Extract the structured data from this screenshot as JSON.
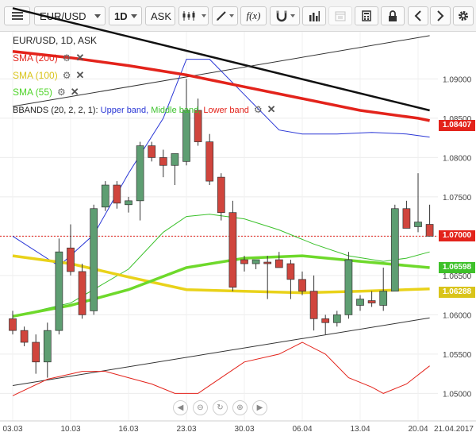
{
  "toolbar": {
    "symbol": "EUR/USD",
    "timeframe": "1D",
    "price_type": "ASK",
    "icons": [
      "hamburger-menu-icon",
      "candlestick-icon",
      "pencil-icon",
      "fx-icon",
      "magnet-icon",
      "bar-chart-icon",
      "calendar-icon",
      "calculator-icon",
      "lock-icon",
      "prev-icon",
      "next-icon",
      "gear-icon"
    ]
  },
  "legend": {
    "title": "EUR/USD, 1D, ASK",
    "sma200": "SMA (200)",
    "sma100": "SMA (100)",
    "sma55": "SMA (55)",
    "bbands_name": "BBANDS (20, 2, 2, 1):",
    "bbands_upper": "Upper band,",
    "bbands_middle": "Middle band,",
    "bbands_lower": "Lower band",
    "colors": {
      "sma200": "#e3231b",
      "sma100": "#e9d21a",
      "sma55": "#6ed92b",
      "upper": "#2a37d6",
      "middle": "#3bc12b",
      "lower": "#e3231b"
    }
  },
  "axis": {
    "y_ticks": [
      "1.09000",
      "1.08500",
      "1.08000",
      "1.07500",
      "1.07000",
      "1.06500",
      "1.06000",
      "1.05500",
      "1.05000"
    ],
    "x_ticks": [
      "03.03",
      "10.03",
      "16.03",
      "23.03",
      "30.03",
      "06.04",
      "13.04",
      "20.04"
    ],
    "x_end_label": "21.04.2017"
  },
  "price_labels": {
    "sma200": {
      "text": "1.08407",
      "color": "#e3231b"
    },
    "current": {
      "text": "1.07000",
      "color": "#e3231b"
    },
    "sma55": {
      "text": "1.06598",
      "color": "#3ec12a"
    },
    "sma100": {
      "text": "1.06288",
      "color": "#d9c41a"
    }
  },
  "nav_icons": [
    "scroll-left-icon",
    "zoom-out-icon",
    "zoom-reset-icon",
    "zoom-in-icon",
    "scroll-right-icon"
  ],
  "chart_data": {
    "type": "candlestick",
    "ylim": [
      1.0465,
      1.096
    ],
    "x_ticks": [
      "03.03",
      "10.03",
      "16.03",
      "23.03",
      "30.03",
      "06.04",
      "13.04",
      "20.04"
    ],
    "last_price": 1.07,
    "candles": [
      {
        "o": 1.0595,
        "h": 1.0605,
        "l": 1.0575,
        "c": 1.058
      },
      {
        "o": 1.058,
        "h": 1.0585,
        "l": 1.056,
        "c": 1.0565
      },
      {
        "o": 1.0565,
        "h": 1.0575,
        "l": 1.0525,
        "c": 1.054
      },
      {
        "o": 1.054,
        "h": 1.059,
        "l": 1.052,
        "c": 1.058
      },
      {
        "o": 1.058,
        "h": 1.0697,
        "l": 1.0575,
        "c": 1.068
      },
      {
        "o": 1.0685,
        "h": 1.0715,
        "l": 1.065,
        "c": 1.0655
      },
      {
        "o": 1.0655,
        "h": 1.0665,
        "l": 1.0595,
        "c": 1.06
      },
      {
        "o": 1.0605,
        "h": 1.074,
        "l": 1.06,
        "c": 1.0735
      },
      {
        "o": 1.0737,
        "h": 1.077,
        "l": 1.0732,
        "c": 1.0765
      },
      {
        "o": 1.0765,
        "h": 1.077,
        "l": 1.0735,
        "c": 1.0742
      },
      {
        "o": 1.074,
        "h": 1.075,
        "l": 1.073,
        "c": 1.0745
      },
      {
        "o": 1.0745,
        "h": 1.082,
        "l": 1.072,
        "c": 1.0815
      },
      {
        "o": 1.0815,
        "h": 1.082,
        "l": 1.0795,
        "c": 1.08
      },
      {
        "o": 1.08,
        "h": 1.081,
        "l": 1.0775,
        "c": 1.079
      },
      {
        "o": 1.079,
        "h": 1.0805,
        "l": 1.0765,
        "c": 1.0805
      },
      {
        "o": 1.0795,
        "h": 1.09,
        "l": 1.079,
        "c": 1.086
      },
      {
        "o": 1.086,
        "h": 1.0875,
        "l": 1.0815,
        "c": 1.082
      },
      {
        "o": 1.082,
        "h": 1.083,
        "l": 1.0765,
        "c": 1.077
      },
      {
        "o": 1.0775,
        "h": 1.078,
        "l": 1.072,
        "c": 1.073
      },
      {
        "o": 1.073,
        "h": 1.0745,
        "l": 1.063,
        "c": 1.0635
      },
      {
        "o": 1.067,
        "h": 1.0675,
        "l": 1.0655,
        "c": 1.0665
      },
      {
        "o": 1.0665,
        "h": 1.067,
        "l": 1.0658,
        "c": 1.067
      },
      {
        "o": 1.0667,
        "h": 1.0675,
        "l": 1.062,
        "c": 1.0665
      },
      {
        "o": 1.067,
        "h": 1.068,
        "l": 1.066,
        "c": 1.066
      },
      {
        "o": 1.0665,
        "h": 1.067,
        "l": 1.062,
        "c": 1.0645
      },
      {
        "o": 1.0645,
        "h": 1.0655,
        "l": 1.0625,
        "c": 1.063
      },
      {
        "o": 1.063,
        "h": 1.065,
        "l": 1.058,
        "c": 1.0595
      },
      {
        "o": 1.0595,
        "h": 1.06,
        "l": 1.0575,
        "c": 1.059
      },
      {
        "o": 1.059,
        "h": 1.0605,
        "l": 1.0585,
        "c": 1.06
      },
      {
        "o": 1.06,
        "h": 1.068,
        "l": 1.0595,
        "c": 1.067
      },
      {
        "o": 1.0612,
        "h": 1.0625,
        "l": 1.0605,
        "c": 1.062
      },
      {
        "o": 1.0618,
        "h": 1.063,
        "l": 1.061,
        "c": 1.0615
      },
      {
        "o": 1.0612,
        "h": 1.066,
        "l": 1.0605,
        "c": 1.063
      },
      {
        "o": 1.063,
        "h": 1.074,
        "l": 1.063,
        "c": 1.0735
      },
      {
        "o": 1.0735,
        "h": 1.0745,
        "l": 1.071,
        "c": 1.071
      },
      {
        "o": 1.0712,
        "h": 1.078,
        "l": 1.0705,
        "c": 1.0718
      },
      {
        "o": 1.0715,
        "h": 1.074,
        "l": 1.07,
        "c": 1.07
      }
    ],
    "sma200": [
      [
        0,
        1.0935
      ],
      [
        5,
        1.0927
      ],
      [
        10,
        1.0917
      ],
      [
        15,
        1.0905
      ],
      [
        20,
        1.089
      ],
      [
        25,
        1.0875
      ],
      [
        30,
        1.086
      ],
      [
        35,
        1.085
      ],
      [
        36,
        1.0847
      ]
    ],
    "sma100": [
      [
        0,
        1.0675
      ],
      [
        5,
        1.0665
      ],
      [
        10,
        1.0648
      ],
      [
        15,
        1.0632
      ],
      [
        20,
        1.063
      ],
      [
        25,
        1.0628
      ],
      [
        30,
        1.063
      ],
      [
        36,
        1.0633
      ]
    ],
    "sma55": [
      [
        0,
        1.0598
      ],
      [
        5,
        1.0612
      ],
      [
        10,
        1.0632
      ],
      [
        15,
        1.066
      ],
      [
        20,
        1.0672
      ],
      [
        25,
        1.0675
      ],
      [
        30,
        1.0668
      ],
      [
        36,
        1.066
      ]
    ],
    "bb_upper": [
      [
        0,
        1.07
      ],
      [
        4,
        1.0662
      ],
      [
        7,
        1.0702
      ],
      [
        10,
        1.078
      ],
      [
        13,
        1.085
      ],
      [
        15,
        1.0925
      ],
      [
        17,
        1.0925
      ],
      [
        20,
        1.088
      ],
      [
        23,
        1.0835
      ],
      [
        25,
        1.083
      ],
      [
        28,
        1.083
      ],
      [
        31,
        1.0832
      ],
      [
        34,
        1.083
      ],
      [
        36,
        1.0826
      ]
    ],
    "bb_middle": [
      [
        0,
        1.0598
      ],
      [
        5,
        1.0615
      ],
      [
        10,
        1.0658
      ],
      [
        13,
        1.0705
      ],
      [
        15,
        1.0725
      ],
      [
        17,
        1.0728
      ],
      [
        20,
        1.0722
      ],
      [
        23,
        1.0708
      ],
      [
        26,
        1.069
      ],
      [
        29,
        1.0675
      ],
      [
        32,
        1.0668
      ],
      [
        34,
        1.0672
      ],
      [
        36,
        1.068
      ]
    ],
    "bb_lower": [
      [
        0,
        1.0497
      ],
      [
        3,
        1.0518
      ],
      [
        6,
        1.0528
      ],
      [
        8,
        1.0528
      ],
      [
        10,
        1.052
      ],
      [
        12,
        1.0512
      ],
      [
        14,
        1.05
      ],
      [
        16,
        1.05
      ],
      [
        18,
        1.052
      ],
      [
        20,
        1.054
      ],
      [
        23,
        1.055
      ],
      [
        25,
        1.0565
      ],
      [
        27,
        1.055
      ],
      [
        29,
        1.052
      ],
      [
        31,
        1.0508
      ],
      [
        32,
        1.05
      ],
      [
        34,
        1.0512
      ],
      [
        36,
        1.0535
      ]
    ],
    "trendlines": [
      {
        "color": "#111111",
        "width": 2.5,
        "points": [
          [
            0,
            1.099
          ],
          [
            36,
            1.086
          ]
        ]
      },
      {
        "color": "#333333",
        "width": 1,
        "points": [
          [
            0,
            1.0865
          ],
          [
            36,
            1.0955
          ]
        ]
      },
      {
        "color": "#333333",
        "width": 1,
        "points": [
          [
            0,
            1.051
          ],
          [
            36,
            1.0596
          ]
        ]
      }
    ]
  }
}
